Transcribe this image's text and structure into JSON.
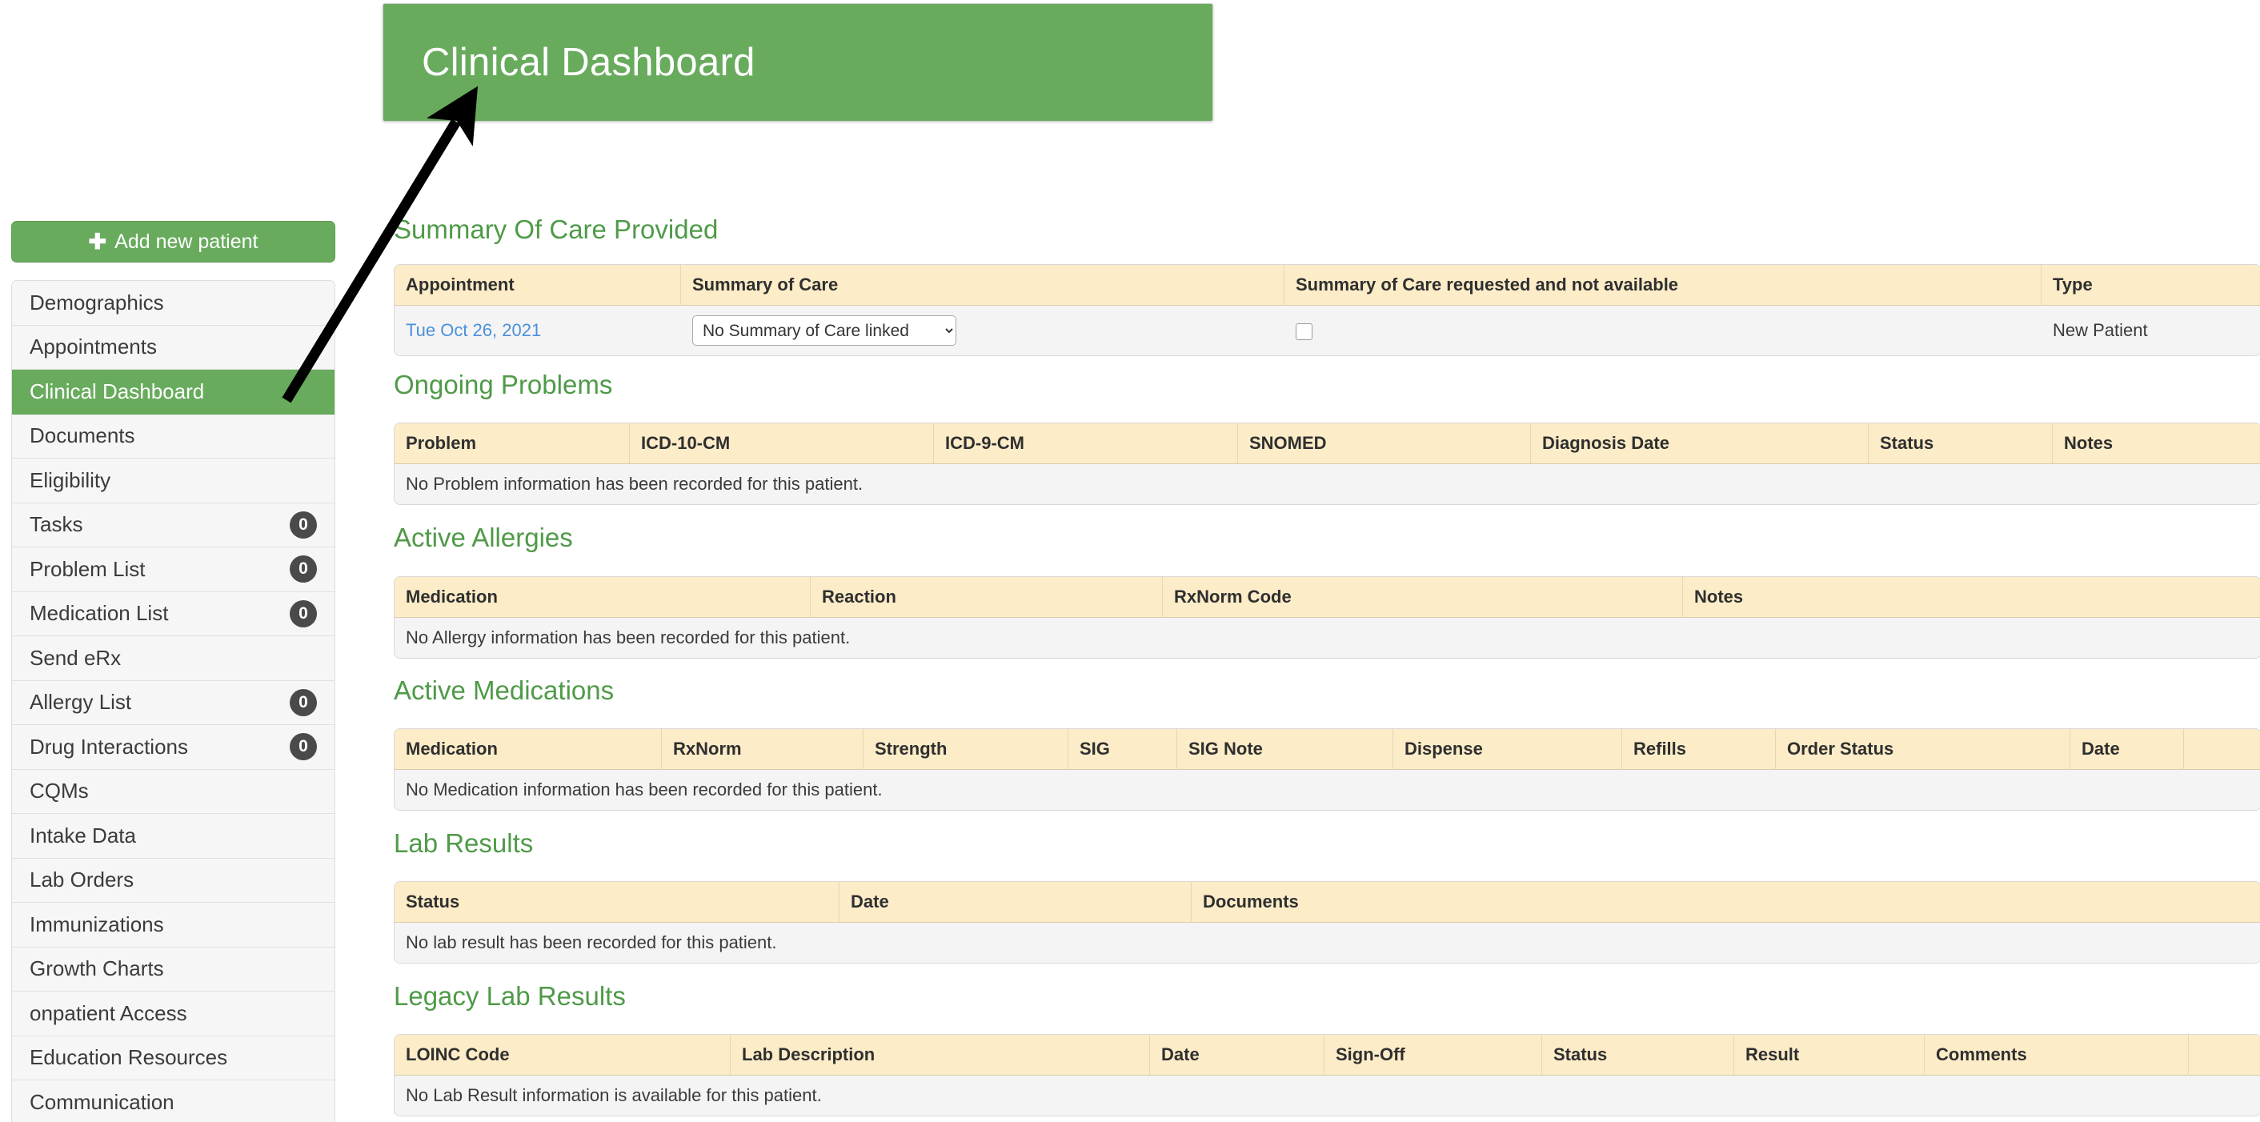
{
  "annotation": {
    "banner_title": "Clinical Dashboard",
    "banner_color": "#68ab5d",
    "arrow_color": "#000000"
  },
  "sidebar": {
    "add_patient_label": "Add new patient",
    "add_patient_icon": "plus-icon",
    "items": [
      {
        "label": "Demographics",
        "badge": null,
        "active": false
      },
      {
        "label": "Appointments",
        "badge": null,
        "active": false
      },
      {
        "label": "Clinical Dashboard",
        "badge": null,
        "active": true
      },
      {
        "label": "Documents",
        "badge": null,
        "active": false
      },
      {
        "label": "Eligibility",
        "badge": null,
        "active": false
      },
      {
        "label": "Tasks",
        "badge": "0",
        "active": false
      },
      {
        "label": "Problem List",
        "badge": "0",
        "active": false
      },
      {
        "label": "Medication List",
        "badge": "0",
        "active": false
      },
      {
        "label": "Send eRx",
        "badge": null,
        "active": false
      },
      {
        "label": "Allergy List",
        "badge": "0",
        "active": false
      },
      {
        "label": "Drug Interactions",
        "badge": "0",
        "active": false
      },
      {
        "label": "CQMs",
        "badge": null,
        "active": false
      },
      {
        "label": "Intake Data",
        "badge": null,
        "active": false
      },
      {
        "label": "Lab Orders",
        "badge": null,
        "active": false
      },
      {
        "label": "Immunizations",
        "badge": null,
        "active": false
      },
      {
        "label": "Growth Charts",
        "badge": null,
        "active": false
      },
      {
        "label": "onpatient Access",
        "badge": null,
        "active": false
      },
      {
        "label": "Education Resources",
        "badge": null,
        "active": false
      },
      {
        "label": "Communication",
        "badge": null,
        "active": false
      }
    ]
  },
  "sections": {
    "summary_of_care": {
      "title": "Summary Of Care Provided",
      "columns": [
        "Appointment",
        "Summary of Care",
        "Summary of Care requested and not available",
        "Type"
      ],
      "row": {
        "appointment": "Tue Oct 26, 2021",
        "summary_of_care_selected": "No Summary of Care linked",
        "requested_not_available_checked": false,
        "type": "New Patient"
      }
    },
    "ongoing_problems": {
      "title": "Ongoing Problems",
      "columns": [
        "Problem",
        "ICD-10-CM",
        "ICD-9-CM",
        "SNOMED",
        "Diagnosis Date",
        "Status",
        "Notes"
      ],
      "empty_message": "No Problem information has been recorded for this patient."
    },
    "active_allergies": {
      "title": "Active Allergies",
      "columns": [
        "Medication",
        "Reaction",
        "RxNorm Code",
        "Notes"
      ],
      "empty_message": "No Allergy information has been recorded for this patient."
    },
    "active_medications": {
      "title": "Active Medications",
      "columns": [
        "Medication",
        "RxNorm",
        "Strength",
        "SIG",
        "SIG Note",
        "Dispense",
        "Refills",
        "Order Status",
        "Date",
        ""
      ],
      "empty_message": "No Medication information has been recorded for this patient."
    },
    "lab_results": {
      "title": "Lab Results",
      "columns": [
        "Status",
        "Date",
        "Documents"
      ],
      "empty_message": "No lab result has been recorded for this patient."
    },
    "legacy_lab_results": {
      "title": "Legacy Lab Results",
      "columns": [
        "LOINC Code",
        "Lab Description",
        "Date",
        "Sign-Off",
        "Status",
        "Result",
        "Comments",
        ""
      ],
      "empty_message": "No Lab Result information is available for this patient."
    }
  }
}
